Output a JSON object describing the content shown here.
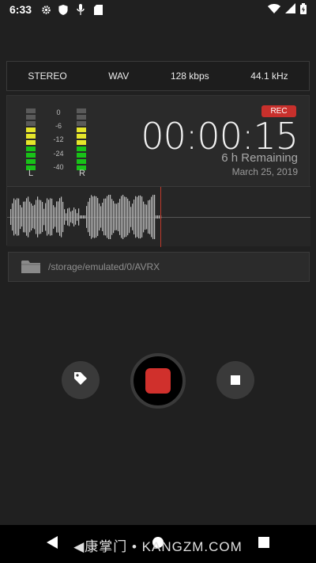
{
  "status": {
    "time": "6:33",
    "icons": [
      "gear-icon",
      "shield-icon",
      "mic-icon",
      "sd-card-icon"
    ],
    "right_icons": [
      "wifi-icon",
      "signal-icon",
      "battery-icon"
    ]
  },
  "format": {
    "channels": "STEREO",
    "codec": "WAV",
    "bitrate": "128 kbps",
    "samplerate": "44.1 kHz"
  },
  "meters": {
    "left_label": "L",
    "right_label": "R",
    "scale": [
      "0",
      "-6",
      "-12",
      "-24",
      "-40"
    ]
  },
  "recording": {
    "badge": "REC",
    "timer": "00:00:15",
    "remaining": "6 h Remaining",
    "date": "March 25, 2019"
  },
  "storage": {
    "path": "/storage/emulated/0/AVRX"
  },
  "colors": {
    "accent_red": "#d0302c",
    "meter_green": "#18c218",
    "meter_yellow": "#e6e62a",
    "meter_gray": "#5a5a5a"
  },
  "watermark": "◀康掌门 • KANGZM.COM"
}
